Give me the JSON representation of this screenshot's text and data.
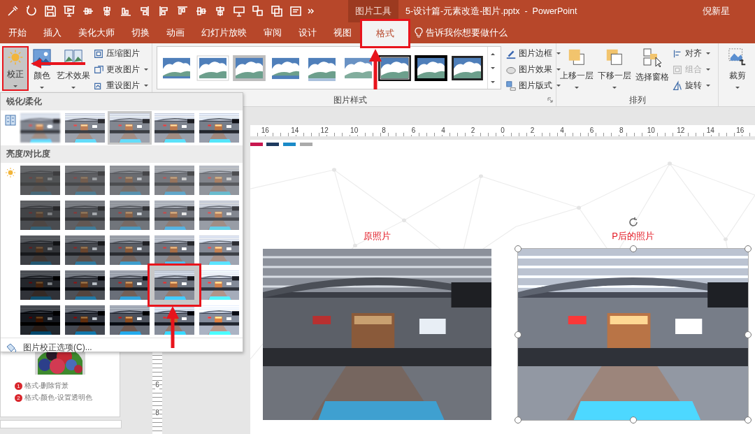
{
  "title_bar": {
    "context_label": "图片工具",
    "title": "5-设计篇-元素改造-图片.pptx  -  PowerPoint",
    "user": "倪新星"
  },
  "tabs": [
    {
      "label": "开始",
      "selected": false,
      "highlighted": false
    },
    {
      "label": "插入",
      "selected": false,
      "highlighted": false
    },
    {
      "label": "美化大师",
      "selected": false,
      "highlighted": false
    },
    {
      "label": "切换",
      "selected": false,
      "highlighted": false
    },
    {
      "label": "动画",
      "selected": false,
      "highlighted": false
    },
    {
      "label": "幻灯片放映",
      "selected": false,
      "highlighted": false
    },
    {
      "label": "审阅",
      "selected": false,
      "highlighted": false
    },
    {
      "label": "设计",
      "selected": false,
      "highlighted": false
    },
    {
      "label": "视图",
      "selected": false,
      "highlighted": false
    },
    {
      "label": "格式",
      "selected": true,
      "highlighted": true
    }
  ],
  "tell_me": "告诉我你想要做什么",
  "ribbon": {
    "adjust": {
      "large_buttons": [
        {
          "label": "校正",
          "selected": true,
          "highlighted": true
        },
        {
          "label": "颜色",
          "selected": false,
          "highlighted": false
        },
        {
          "label": "艺术效果",
          "selected": false,
          "highlighted": false
        }
      ],
      "small_buttons": [
        "压缩图片",
        "更改图片",
        "重设图片"
      ]
    },
    "picture_styles": {
      "label": "图片样式",
      "gallery": [
        {
          "kind": "plain"
        },
        {
          "kind": "white-border"
        },
        {
          "kind": "shadow"
        },
        {
          "kind": "rounded"
        },
        {
          "kind": "reflected"
        },
        {
          "kind": "soft"
        },
        {
          "kind": "double-frame"
        },
        {
          "kind": "black-frame"
        },
        {
          "kind": "thick-frame"
        }
      ],
      "buttons": [
        "图片边框",
        "图片效果",
        "图片版式"
      ]
    },
    "arrange": {
      "label": "排列",
      "large_buttons": [
        "上移一层",
        "下移一层",
        "选择窗格"
      ],
      "small_buttons": [
        {
          "label": "对齐",
          "disabled": false
        },
        {
          "label": "组合",
          "disabled": true
        },
        {
          "label": "旋转",
          "disabled": false
        }
      ]
    },
    "size": {
      "large_buttons": [
        "裁剪"
      ]
    }
  },
  "corrections_menu": {
    "sections": [
      {
        "title": "锐化/柔化",
        "kind": "sharpen",
        "thumbnails": [
          {
            "selected": false,
            "highlighted": false
          },
          {
            "selected": false,
            "highlighted": false
          },
          {
            "selected": true,
            "highlighted": false
          },
          {
            "selected": false,
            "highlighted": false
          },
          {
            "selected": false,
            "highlighted": false
          }
        ]
      },
      {
        "title": "亮度/对比度",
        "kind": "brightness",
        "thumbnails": [
          {
            "selected": false,
            "highlighted": false
          },
          {
            "selected": false,
            "highlighted": false
          },
          {
            "selected": false,
            "highlighted": false
          },
          {
            "selected": false,
            "highlighted": false
          },
          {
            "selected": false,
            "highlighted": false
          },
          {
            "selected": false,
            "highlighted": false
          },
          {
            "selected": false,
            "highlighted": false
          },
          {
            "selected": false,
            "highlighted": false
          },
          {
            "selected": false,
            "highlighted": false
          },
          {
            "selected": false,
            "highlighted": false
          },
          {
            "selected": false,
            "highlighted": false
          },
          {
            "selected": false,
            "highlighted": false
          },
          {
            "selected": false,
            "highlighted": false
          },
          {
            "selected": false,
            "highlighted": false
          },
          {
            "selected": false,
            "highlighted": false
          },
          {
            "selected": false,
            "highlighted": false
          },
          {
            "selected": false,
            "highlighted": false
          },
          {
            "selected": false,
            "highlighted": false
          },
          {
            "selected": true,
            "highlighted": true
          },
          {
            "selected": false,
            "highlighted": false
          },
          {
            "selected": false,
            "highlighted": false
          },
          {
            "selected": false,
            "highlighted": false
          },
          {
            "selected": false,
            "highlighted": false
          },
          {
            "selected": false,
            "highlighted": false
          },
          {
            "selected": false,
            "highlighted": false
          }
        ]
      }
    ],
    "footer": "图片校正选项(C)..."
  },
  "slide_panel": {
    "captions": [
      {
        "number": "1",
        "text": "格式-删除背景"
      },
      {
        "number": "2",
        "text": "格式-颜色-设置透明色"
      }
    ]
  },
  "rulers": {
    "horizontal": [
      "16",
      "14",
      "12",
      "10",
      "8",
      "6",
      "4",
      "2",
      "0",
      "2",
      "4",
      "6",
      "8",
      "10",
      "12",
      "14",
      "16"
    ],
    "vertical": [
      "6",
      "8"
    ]
  },
  "slide": {
    "photos": [
      {
        "caption": "原照片",
        "corrected": false,
        "selected": false
      },
      {
        "caption": "P后的照片",
        "corrected": true,
        "selected": true
      }
    ]
  }
}
